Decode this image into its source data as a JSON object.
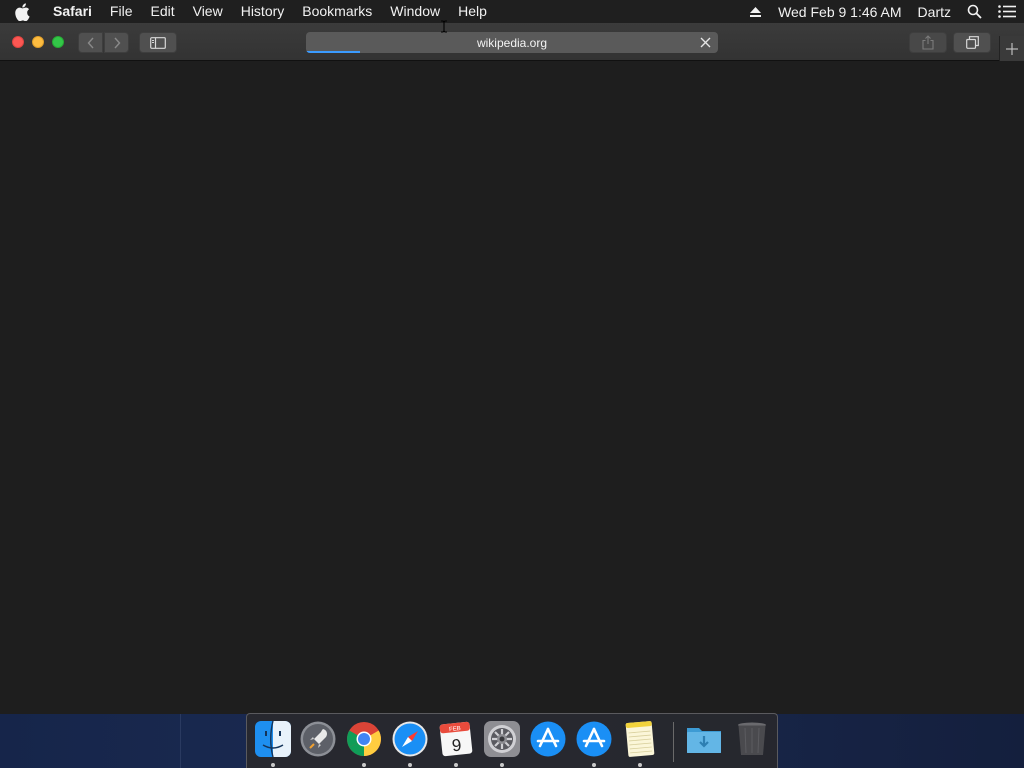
{
  "menubar": {
    "app_name": "Safari",
    "menus": [
      "File",
      "Edit",
      "View",
      "History",
      "Bookmarks",
      "Window",
      "Help"
    ],
    "clock": "Wed Feb 9  1:46 AM",
    "user": "Dartz",
    "icons": [
      "apple-icon",
      "eject-icon",
      "spotlight-search-icon",
      "notification-center-icon"
    ]
  },
  "browser": {
    "url": "wikipedia.org",
    "load_progress": 0.13,
    "toolbar_icons": [
      "back-icon",
      "forward-icon",
      "sidebar-icon",
      "stop-loading-icon",
      "share-icon",
      "tab-overview-icon",
      "new-tab-icon"
    ]
  },
  "dock": {
    "calendar_month": "FEB",
    "calendar_day": "9",
    "apps": [
      "finder",
      "launchpad",
      "chrome",
      "safari",
      "calendar",
      "system-preferences",
      "app-store",
      "app-store",
      "notes",
      "downloads-folder",
      "trash"
    ]
  },
  "colors": {
    "accent": "#3b9bff",
    "close": "#fc5753",
    "minimize": "#fdbc40",
    "maximize": "#33c748"
  }
}
